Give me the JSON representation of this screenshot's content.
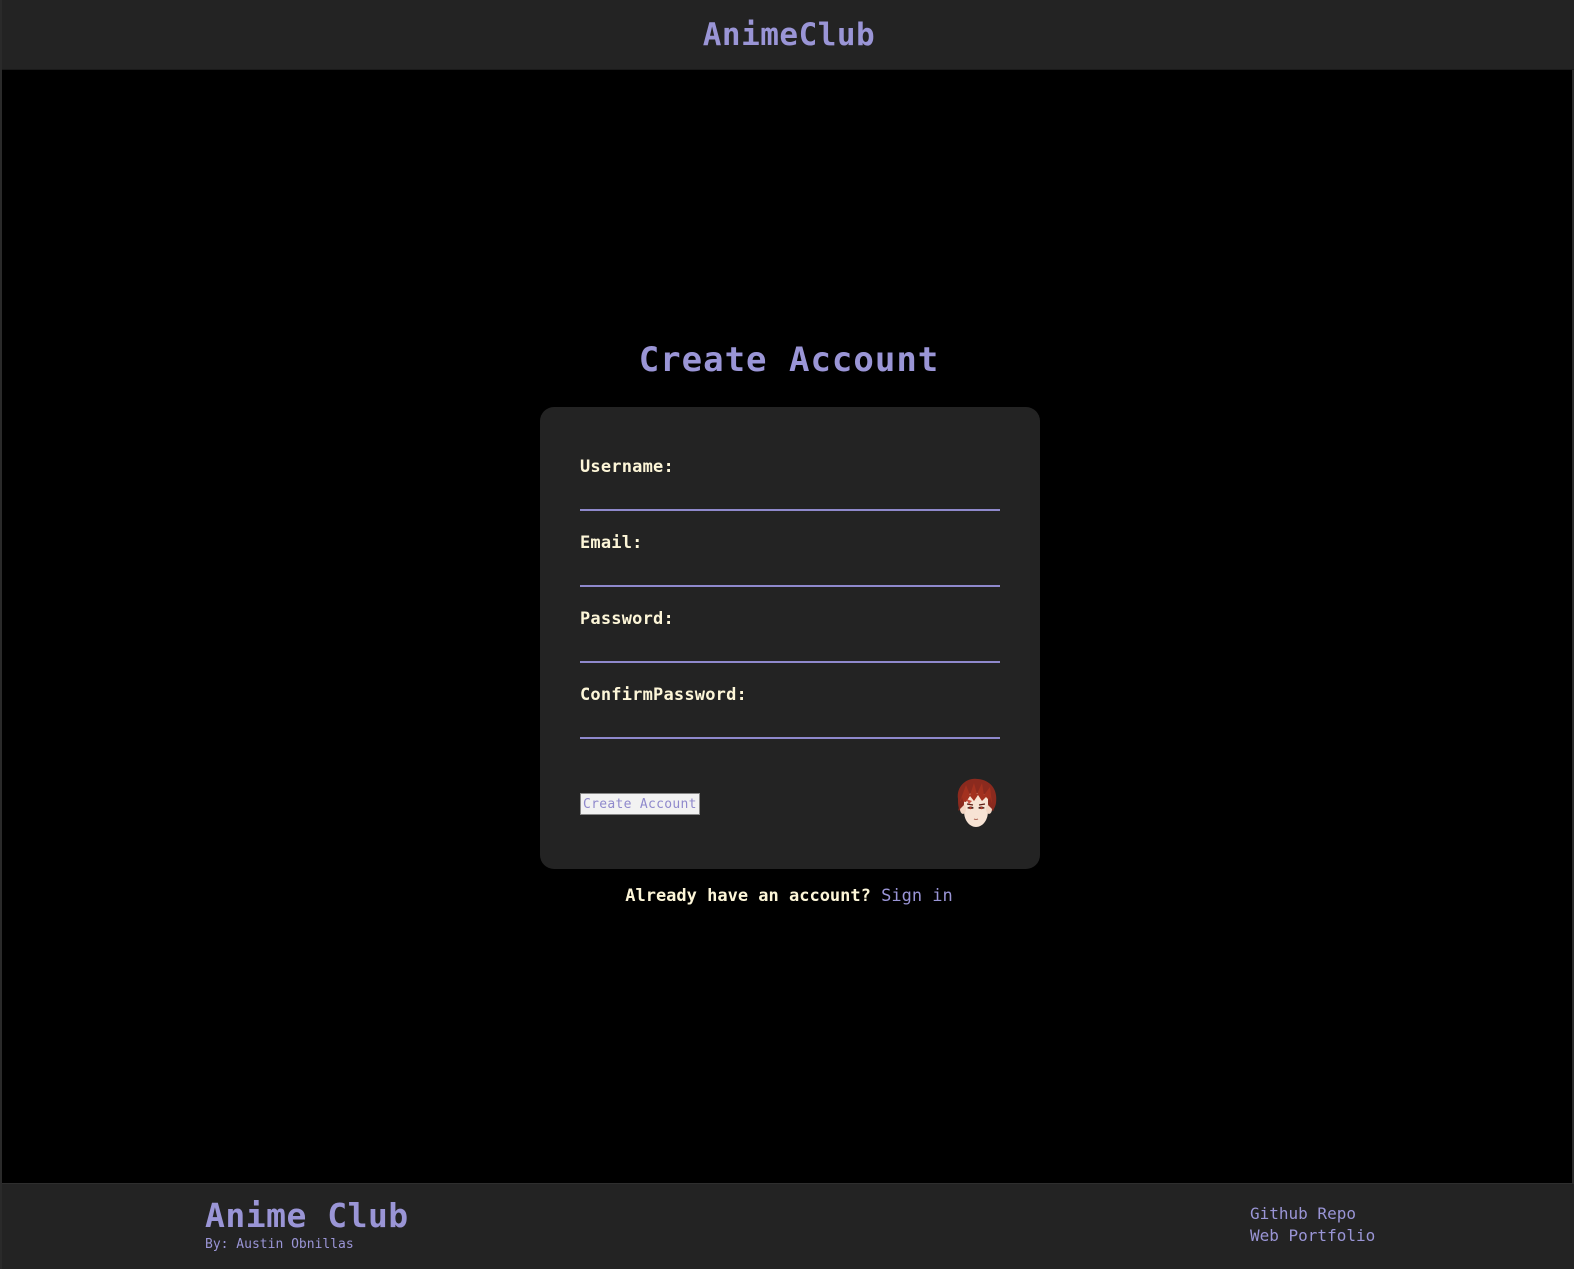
{
  "header": {
    "brand": "AnimeClub"
  },
  "main": {
    "title": "Create Account",
    "form": {
      "fields": [
        {
          "label": "Username:",
          "value": "",
          "type": "text"
        },
        {
          "label": "Email:",
          "value": "",
          "type": "email"
        },
        {
          "label": "Password:",
          "value": "",
          "type": "password"
        },
        {
          "label": "ConfirmPassword:",
          "value": "",
          "type": "password"
        }
      ],
      "submit_label": "Create Account",
      "avatar_icon": "anime-character-avatar-icon"
    },
    "signin": {
      "prompt": "Already have an account? ",
      "link_label": "Sign in"
    }
  },
  "footer": {
    "title": "Anime Club",
    "byline": "By: Austin Obnillas",
    "links": [
      "Github Repo",
      "Web Portfolio"
    ]
  },
  "colors": {
    "accent": "#9a95d6",
    "label": "#fdf6d8",
    "panel": "#232323",
    "background": "#000000"
  }
}
